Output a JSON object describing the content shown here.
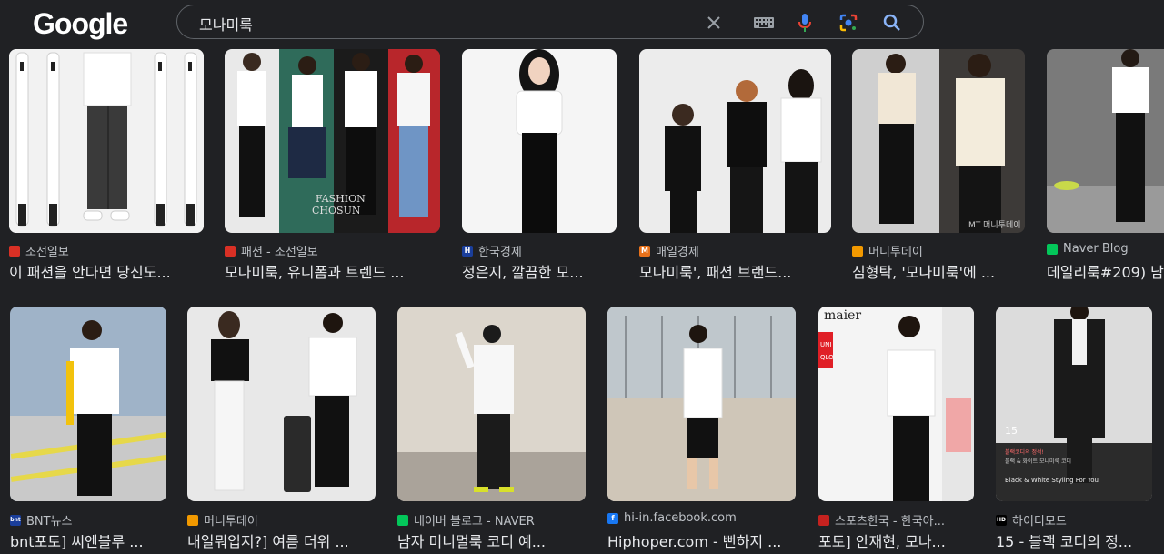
{
  "header": {
    "logo": "Google",
    "search": {
      "query": "모나미룩"
    }
  },
  "icons": {
    "clear": "close-icon",
    "keyboard": "keyboard-icon",
    "voice": "microphone-icon",
    "lens": "google-lens-icon",
    "search": "search-icon"
  },
  "results": [
    {
      "source": "조선일보",
      "title": "이 패션을 안다면 당신도...",
      "fav_color": "#d93025",
      "fav_letter": ""
    },
    {
      "source": "패션 - 조선일보",
      "title": "모나미룩, 유니폼과 트렌드 ...",
      "fav_color": "#d93025",
      "fav_letter": ""
    },
    {
      "source": "한국경제",
      "title": "정은지, 깔끔한 모...",
      "fav_color": "#1a3e9b",
      "fav_letter": "H"
    },
    {
      "source": "매일경제",
      "title": "모나미룩', 패션 브랜드...",
      "fav_color": "#e8711a",
      "fav_letter": "M"
    },
    {
      "source": "머니투데이",
      "title": "심형탁, '모나미룩'에 ...",
      "fav_color": "#f29900",
      "fav_letter": ""
    },
    {
      "source": "Naver Blog",
      "title": "데일리룩#209) 남",
      "fav_color": "#03c75a",
      "fav_letter": ""
    },
    {
      "source": "BNT뉴스",
      "title": "bnt포토] 씨엔블루 ...",
      "fav_color": "#1a3e9b",
      "fav_letter": "bnt"
    },
    {
      "source": "머니투데이",
      "title": "내일뭐입지?] 여름 더위 ...",
      "fav_color": "#f29900",
      "fav_letter": ""
    },
    {
      "source": "네이버 블로그 - NAVER",
      "title": "남자 미니멀룩 코디 예...",
      "fav_color": "#03c75a",
      "fav_letter": ""
    },
    {
      "source": "hi-in.facebook.com",
      "title": "Hiphoper.com - 뻔하지 ...",
      "fav_color": "#1877f2",
      "fav_letter": "f"
    },
    {
      "source": "스포츠한국 - 한국아...",
      "title": "포토] 안재현, 모나...",
      "fav_color": "#c5221f",
      "fav_letter": ""
    },
    {
      "source": "하이디모드",
      "title": "15 - 블랙 코디의 정...",
      "fav_color": "#000000",
      "fav_letter": "HD"
    }
  ],
  "image_text": {
    "fashion_watermark": "FASHION CHOSUN",
    "mt_watermark": "MT 머니투데이",
    "maier": "maier",
    "uni": "UNI QLO",
    "hd_15": "15",
    "hd_caption1": "블랙코디의 정석!",
    "hd_caption2": "블랙 & 화이트 모니미룩 코디",
    "hd_caption3": "Black & White Styling For You"
  }
}
